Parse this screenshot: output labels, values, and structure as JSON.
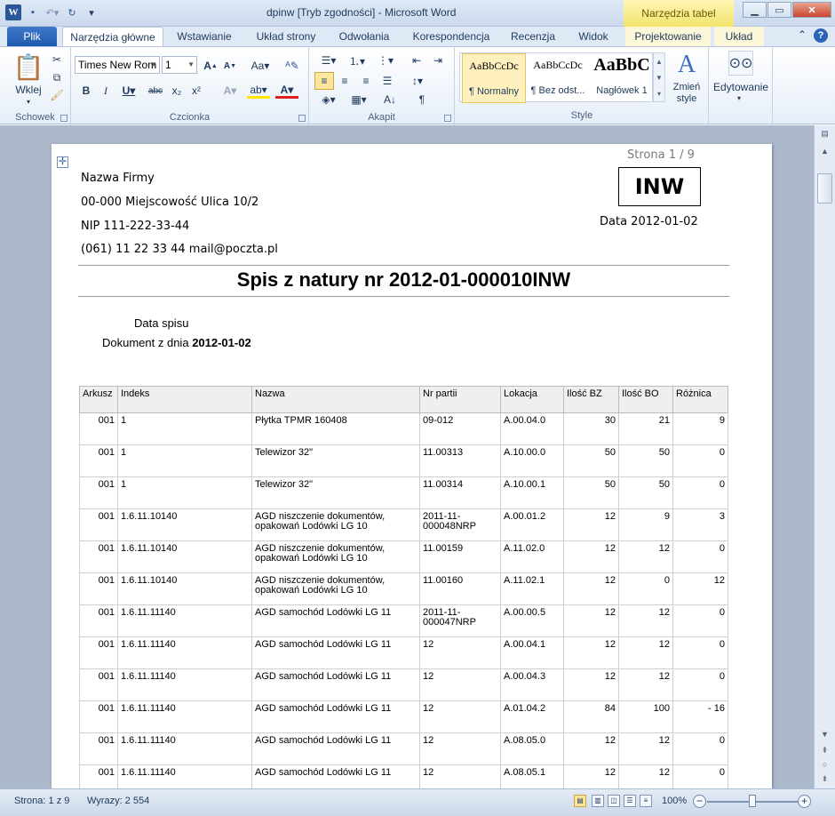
{
  "window": {
    "title": "dpinw [Tryb zgodności]  -  Microsoft Word",
    "context_tab_group": "Narzędzia tabel"
  },
  "ribbon_tabs": {
    "file": "Plik",
    "items": [
      "Narzędzia główne",
      "Wstawianie",
      "Układ strony",
      "Odwołania",
      "Korespondencja",
      "Recenzja",
      "Widok",
      "Projektowanie",
      "Układ"
    ]
  },
  "ribbon": {
    "clipboard": {
      "paste": "Wklej",
      "label": "Schowek"
    },
    "font": {
      "name": "Times New Rom",
      "size": "1",
      "label": "Czcionka"
    },
    "paragraph": {
      "label": "Akapit"
    },
    "styles": {
      "items": [
        {
          "sample": "AaBbCcDc",
          "name": "¶ Normalny"
        },
        {
          "sample": "AaBbCcDc",
          "name": "¶ Bez odst..."
        },
        {
          "sample": "AaBbC",
          "name": "Nagłówek 1"
        }
      ],
      "change": "Zmień style",
      "label": "Style"
    },
    "editing": {
      "label": "Edytowanie"
    }
  },
  "document": {
    "page_number": "Strona 1 / 9",
    "company": {
      "name": "Nazwa Firmy",
      "address": "00-000  Miejscowość  Ulica  10/2",
      "nip": "NIP  111-222-33-44",
      "contact": "(061)  11  22  33  44   mail@poczta.pl"
    },
    "badge": "INW",
    "date_line": "Data  2012-01-02",
    "title": "Spis z natury nr 2012-01-000010INW",
    "data_spisu_label": "Data spisu",
    "dokument_label": "Dokument z dnia",
    "dokument_date": "2012-01-02",
    "table": {
      "headers": [
        "Arkusz",
        "Indeks",
        "Nazwa",
        "Nr partii",
        "Lokacja",
        "Ilość BZ",
        "Ilość BO",
        "Różnica"
      ],
      "rows": [
        [
          "001",
          "1",
          "Płytka TPMR 160408",
          "09-012",
          "A.00.04.0",
          "30",
          "21",
          "9"
        ],
        [
          "001",
          "1",
          "Telewizor 32\"",
          "11.00313",
          "A.10.00.0",
          "50",
          "50",
          "0"
        ],
        [
          "001",
          "1",
          "Telewizor 32\"",
          "11.00314",
          "A.10.00.1",
          "50",
          "50",
          "0"
        ],
        [
          "001",
          "1.6.11.10140",
          "AGD niszczenie dokumentów, opakowań Lodówki LG 10",
          "2011-11-000048NRP",
          "A.00.01.2",
          "12",
          "9",
          "3"
        ],
        [
          "001",
          "1.6.11.10140",
          "AGD niszczenie dokumentów, opakowań Lodówki LG 10",
          "11.00159",
          "A.11.02.0",
          "12",
          "12",
          "0"
        ],
        [
          "001",
          "1.6.11.10140",
          "AGD niszczenie dokumentów, opakowań Lodówki LG 10",
          "11.00160",
          "A.11.02.1",
          "12",
          "0",
          "12"
        ],
        [
          "001",
          "1.6.11.11140",
          "AGD samochód Lodówki LG 11",
          "2011-11-000047NRP",
          "A.00.00.5",
          "12",
          "12",
          "0"
        ],
        [
          "001",
          "1.6.11.11140",
          "AGD samochód Lodówki LG 11",
          "12",
          "A.00.04.1",
          "12",
          "12",
          "0"
        ],
        [
          "001",
          "1.6.11.11140",
          "AGD samochód Lodówki LG 11",
          "12",
          "A.00.04.3",
          "12",
          "12",
          "0"
        ],
        [
          "001",
          "1.6.11.11140",
          "AGD samochód Lodówki LG 11",
          "12",
          "A.01.04.2",
          "84",
          "100",
          "- 16"
        ],
        [
          "001",
          "1.6.11.11140",
          "AGD samochód Lodówki LG 11",
          "12",
          "A.08.05.0",
          "12",
          "12",
          "0"
        ],
        [
          "001",
          "1.6.11.11140",
          "AGD samochód Lodówki LG 11",
          "12",
          "A.08.05.1",
          "12",
          "12",
          "0"
        ]
      ]
    }
  },
  "statusbar": {
    "page": "Strona: 1 z 9",
    "words": "Wyrazy: 2 554",
    "zoom": "100%"
  }
}
